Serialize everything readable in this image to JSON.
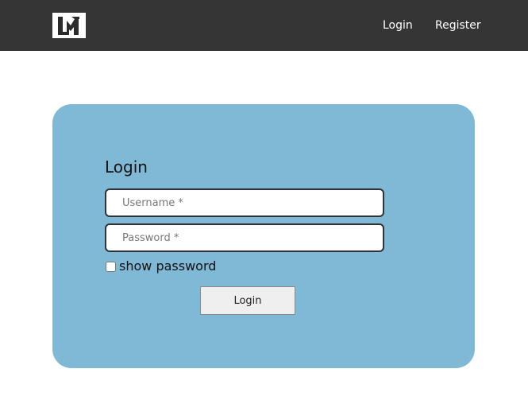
{
  "navbar": {
    "logo_icon": "brand-logo-icon",
    "links": [
      {
        "label": "Login"
      },
      {
        "label": "Register"
      }
    ]
  },
  "login_form": {
    "title": "Login",
    "username": {
      "value": "",
      "placeholder": "Username *"
    },
    "password": {
      "value": "",
      "placeholder": "Password *"
    },
    "show_password_label": "show password",
    "show_password_checked": false,
    "submit_label": "Login"
  },
  "colors": {
    "navbar_bg": "#353535",
    "card_bg": "#80b9d6",
    "button_bg": "#efefef"
  }
}
